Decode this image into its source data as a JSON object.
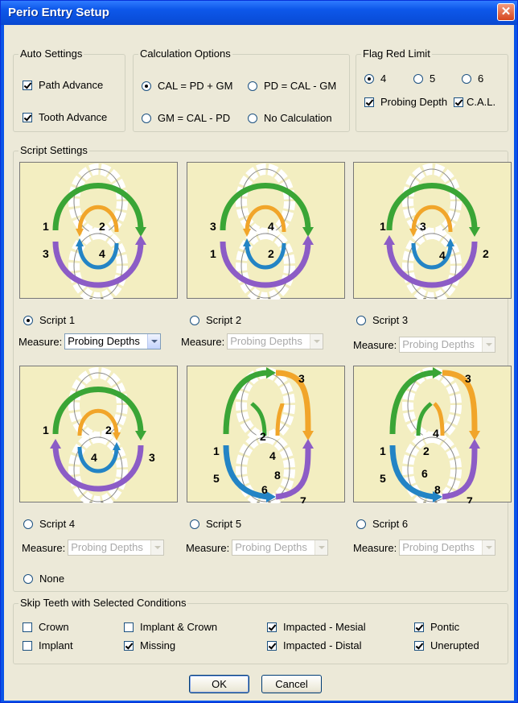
{
  "window": {
    "title": "Perio Entry Setup",
    "close_glyph": "✕"
  },
  "auto_settings": {
    "legend": "Auto Settings",
    "options": [
      {
        "label": "Path Advance",
        "checked": true
      },
      {
        "label": "Tooth Advance",
        "checked": true
      }
    ]
  },
  "calculation": {
    "legend": "Calculation Options",
    "options": [
      {
        "label": "CAL = PD + GM",
        "selected": true
      },
      {
        "label": "PD = CAL - GM",
        "selected": false
      },
      {
        "label": "GM = CAL - PD",
        "selected": false
      },
      {
        "label": "No Calculation",
        "selected": false
      }
    ]
  },
  "flag_red": {
    "legend": "Flag Red Limit",
    "limits": [
      {
        "label": "4",
        "selected": true
      },
      {
        "label": "5",
        "selected": false
      },
      {
        "label": "6",
        "selected": false
      }
    ],
    "checks": [
      {
        "label": "Probing Depth",
        "checked": true
      },
      {
        "label": "C.A.L.",
        "checked": true
      }
    ]
  },
  "script_settings": {
    "legend": "Script Settings",
    "measure_label": "Measure:",
    "scripts": [
      {
        "label": "Script 1",
        "selected": true,
        "measure": "Probing Depths",
        "enabled": true,
        "numbers": [
          "1",
          "2",
          "3",
          "4"
        ]
      },
      {
        "label": "Script 2",
        "selected": false,
        "measure": "Probing Depths",
        "enabled": false,
        "numbers": [
          "3",
          "4",
          "1",
          "2"
        ]
      },
      {
        "label": "Script 3",
        "selected": false,
        "measure": "Probing Depths",
        "enabled": false,
        "numbers": [
          "1",
          "3",
          "4",
          "2"
        ]
      },
      {
        "label": "Script 4",
        "selected": false,
        "measure": "Probing Depths",
        "enabled": false,
        "numbers": [
          "1",
          "2",
          "4",
          "3"
        ]
      },
      {
        "label": "Script 5",
        "selected": false,
        "measure": "Probing Depths",
        "enabled": false,
        "numbers": [
          "3",
          "2",
          "4",
          "1",
          "5",
          "8",
          "6",
          "7"
        ]
      },
      {
        "label": "Script 6",
        "selected": false,
        "measure": "Probing Depths",
        "enabled": false,
        "numbers": [
          "3",
          "4",
          "1",
          "2",
          "5",
          "6",
          "8",
          "7"
        ]
      }
    ],
    "none_label": "None",
    "none_selected": false
  },
  "skip_teeth": {
    "legend": "Skip Teeth with Selected Conditions",
    "options": [
      {
        "label": "Crown",
        "checked": false
      },
      {
        "label": "Implant",
        "checked": false
      },
      {
        "label": "Implant & Crown",
        "checked": false
      },
      {
        "label": "Missing",
        "checked": true
      },
      {
        "label": "Impacted - Mesial",
        "checked": true
      },
      {
        "label": "Impacted - Distal",
        "checked": true
      },
      {
        "label": "Pontic",
        "checked": true
      },
      {
        "label": "Unerupted",
        "checked": true
      }
    ]
  },
  "buttons": {
    "ok": "OK",
    "cancel": "Cancel"
  },
  "colors": {
    "green": "#3aa536",
    "orange": "#f1a52a",
    "purple": "#8c5cc6",
    "blue": "#2384c5",
    "panel": "#f3eec1"
  }
}
